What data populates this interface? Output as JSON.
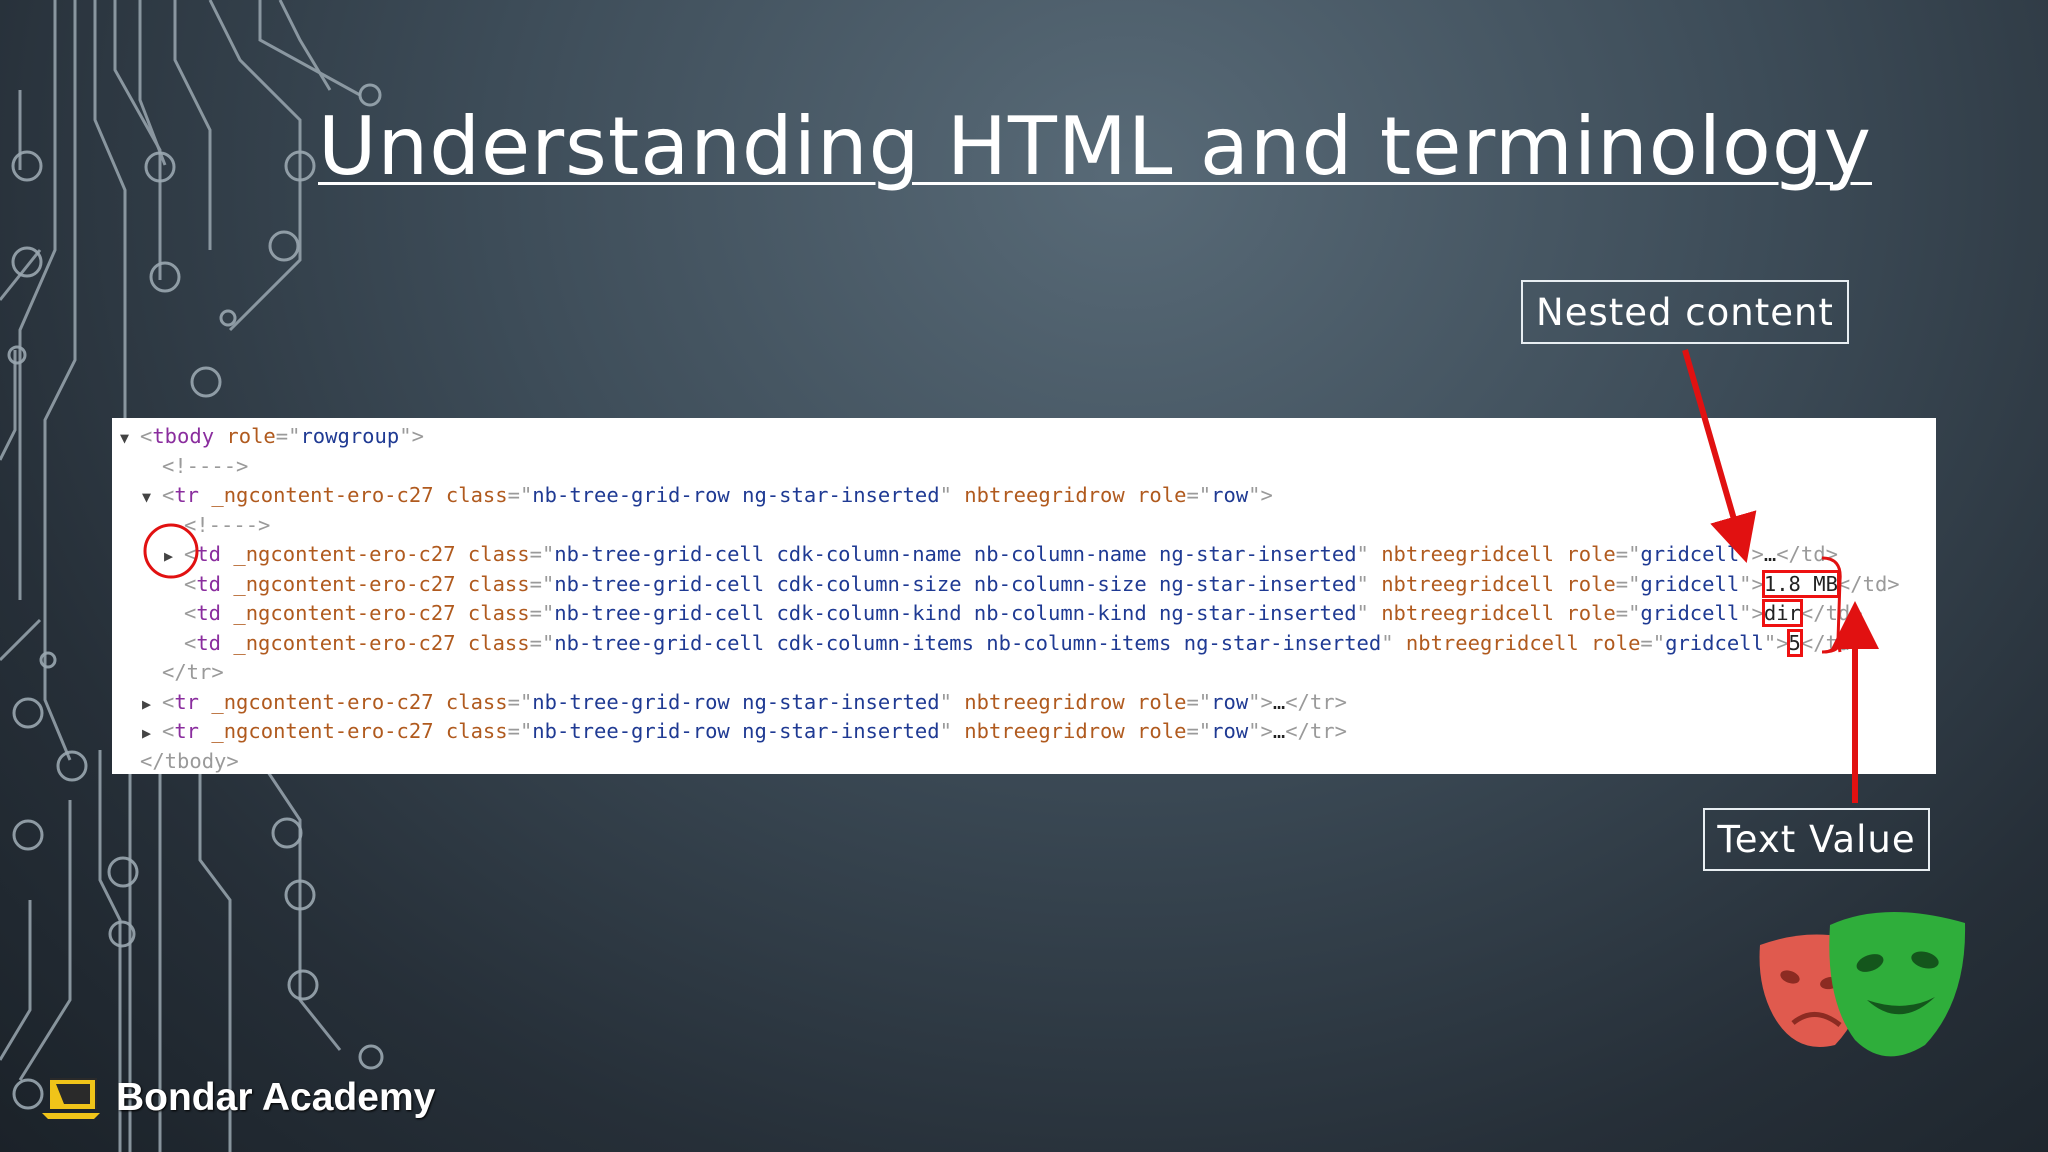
{
  "slide": {
    "title": "Understanding HTML and terminology"
  },
  "labels": {
    "nested_content": "Nested content",
    "text_value": "Text Value"
  },
  "code": {
    "lines": [
      {
        "indent": 0,
        "tri": "▼",
        "open": "tbody",
        "attrs": [
          [
            "role",
            "rowgroup"
          ]
        ],
        "close_bracket": ">"
      },
      {
        "indent": 1,
        "comment": "<!---->"
      },
      {
        "indent": 1,
        "tri": "▼",
        "open": "tr",
        "attrs": [
          [
            "_ngcontent-ero-c27",
            ""
          ],
          [
            "class",
            "nb-tree-grid-row ng-star-inserted"
          ],
          [
            "nbtreegridrow",
            ""
          ],
          [
            "role",
            "row"
          ]
        ],
        "close_bracket": ">"
      },
      {
        "indent": 2,
        "comment": "<!---->"
      },
      {
        "indent": 2,
        "tri": "▶",
        "open": "td",
        "attrs": [
          [
            "_ngcontent-ero-c27",
            ""
          ],
          [
            "class",
            "nb-tree-grid-cell cdk-column-name nb-column-name ng-star-inserted"
          ],
          [
            "nbtreegridcell",
            ""
          ],
          [
            "role",
            "gridcell"
          ]
        ],
        "close_bracket": ">",
        "inner": "…",
        "end": "</td>"
      },
      {
        "indent": 2,
        "open": "td",
        "attrs": [
          [
            "_ngcontent-ero-c27",
            ""
          ],
          [
            "class",
            "nb-tree-grid-cell cdk-column-size nb-column-size ng-star-inserted"
          ],
          [
            "nbtreegridcell",
            ""
          ],
          [
            "role",
            "gridcell"
          ]
        ],
        "close_bracket": ">",
        "inner": "1.8 MB",
        "end": "</td>"
      },
      {
        "indent": 2,
        "open": "td",
        "attrs": [
          [
            "_ngcontent-ero-c27",
            ""
          ],
          [
            "class",
            "nb-tree-grid-cell cdk-column-kind nb-column-kind ng-star-inserted"
          ],
          [
            "nbtreegridcell",
            ""
          ],
          [
            "role",
            "gridcell"
          ]
        ],
        "close_bracket": ">",
        "inner": "dir",
        "end": "</td>"
      },
      {
        "indent": 2,
        "open": "td",
        "attrs": [
          [
            "_ngcontent-ero-c27",
            ""
          ],
          [
            "class",
            "nb-tree-grid-cell cdk-column-items nb-column-items ng-star-inserted"
          ],
          [
            "nbtreegridcell",
            ""
          ],
          [
            "role",
            "gridcell"
          ]
        ],
        "close_bracket": ">",
        "inner": "5",
        "end": "</td>"
      },
      {
        "indent": 1,
        "end_only": "</tr>"
      },
      {
        "indent": 1,
        "tri": "▶",
        "open": "tr",
        "attrs": [
          [
            "_ngcontent-ero-c27",
            ""
          ],
          [
            "class",
            "nb-tree-grid-row ng-star-inserted"
          ],
          [
            "nbtreegridrow",
            ""
          ],
          [
            "role",
            "row"
          ]
        ],
        "close_bracket": ">",
        "inner": "…",
        "end": "</tr>"
      },
      {
        "indent": 1,
        "tri": "▶",
        "open": "tr",
        "attrs": [
          [
            "_ngcontent-ero-c27",
            ""
          ],
          [
            "class",
            "nb-tree-grid-row ng-star-inserted"
          ],
          [
            "nbtreegridrow",
            ""
          ],
          [
            "role",
            "row"
          ]
        ],
        "close_bracket": ">",
        "inner": "…",
        "end": "</tr>"
      },
      {
        "indent": 0,
        "end_only": "</tbody>"
      }
    ]
  },
  "brand": {
    "name": "Bondar Academy"
  },
  "colors": {
    "annotation_red": "#e11111",
    "mask_red": "#e05a4e",
    "mask_green": "#2fae3b"
  }
}
